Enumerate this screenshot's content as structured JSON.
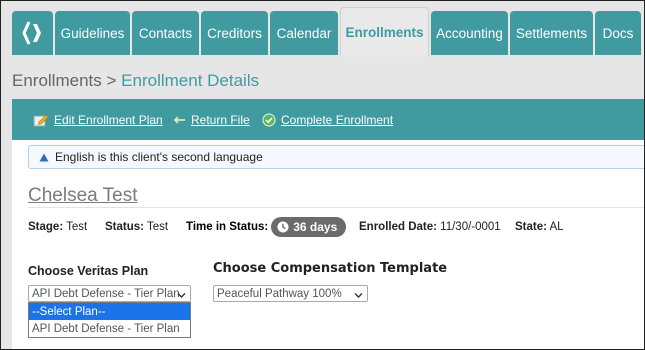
{
  "nav": {
    "tabs": [
      {
        "label": "Guidelines"
      },
      {
        "label": "Contacts"
      },
      {
        "label": "Creditors"
      },
      {
        "label": "Calendar"
      },
      {
        "label": "Enrollments"
      },
      {
        "label": "Accounting"
      },
      {
        "label": "Settlements"
      },
      {
        "label": "Docs"
      }
    ],
    "active_tab": "Enrollments"
  },
  "breadcrumb": {
    "parent": "Enrollments",
    "separator": ">",
    "current": "Enrollment Details"
  },
  "toolbar": {
    "edit_plan": "Edit Enrollment Plan",
    "return_file": "Return File",
    "complete": "Complete Enrollment"
  },
  "alert": {
    "text": "English is this client's second language"
  },
  "client": {
    "name": "Chelsea Test"
  },
  "status_row": {
    "stage_label": "Stage:",
    "stage_value": "Test",
    "status_label": "Status:",
    "status_value": "Test",
    "time_label": "Time in Status:",
    "time_value": "36 days",
    "enrolled_label": "Enrolled Date:",
    "enrolled_value": "11/30/-0001",
    "state_label": "State:",
    "state_value": "AL"
  },
  "veritas": {
    "label": "Choose Veritas Plan",
    "selected": "API Debt Defense - Tier Plan",
    "options": [
      "--Select Plan--",
      "API Debt Defense - Tier Plan"
    ]
  },
  "compensation": {
    "label": "Choose Compensation Template",
    "selected": "Peaceful Pathway 100%"
  },
  "colors": {
    "teal": "#3f9ba0",
    "highlight": "#1a73e8"
  },
  "icons": [
    "app-logo-icon",
    "edit-plan-icon",
    "return-arrow-icon",
    "check-circle-icon",
    "warning-triangle-icon",
    "clock-icon",
    "chevron-down-icon"
  ]
}
